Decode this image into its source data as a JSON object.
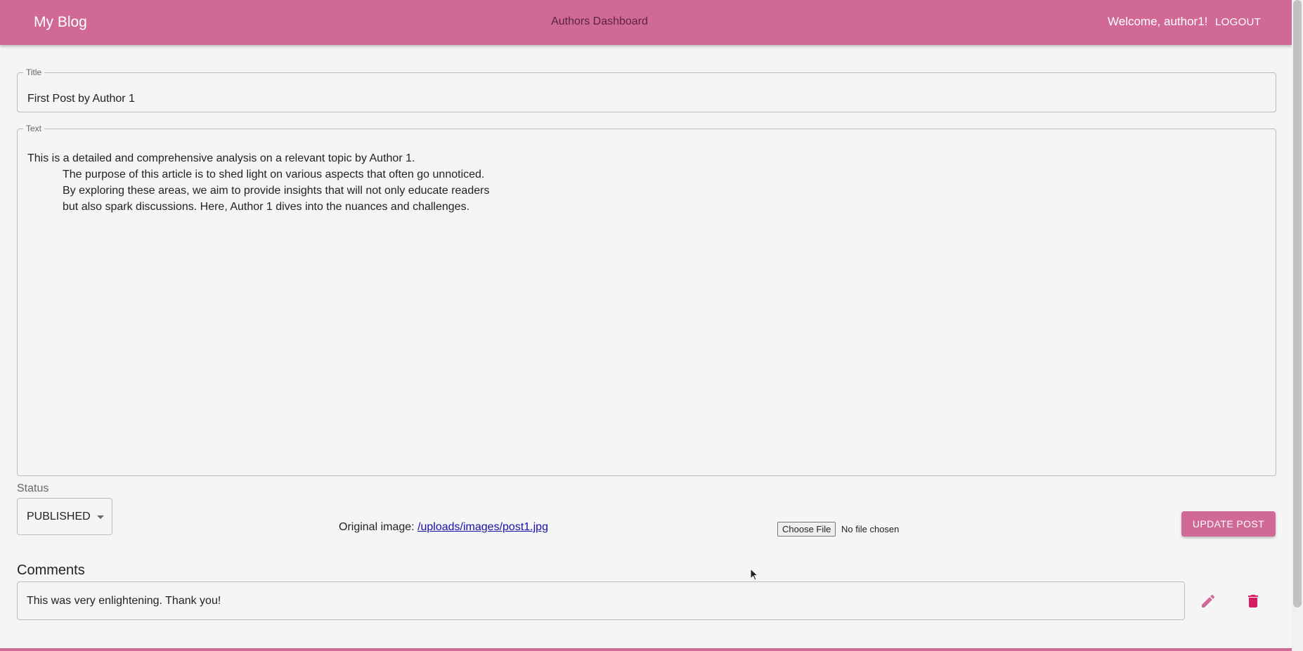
{
  "appbar": {
    "brand": "My Blog",
    "title": "Authors Dashboard",
    "welcome": "Welcome, author1!",
    "logout_label": "LOGOUT"
  },
  "form": {
    "title_label": "Title",
    "title_value": "First Post by Author 1",
    "text_label": "Text",
    "text_lines": [
      "This is a detailed and comprehensive analysis on a relevant topic by Author 1.",
      "The purpose of this article is to shed light on various aspects that often go unnoticed.",
      "By exploring these areas, we aim to provide insights that will not only educate readers",
      "but also spark discussions. Here, Author 1 dives into the nuances and challenges."
    ],
    "status_label": "Status",
    "status_value": "PUBLISHED",
    "original_image_label": "Original image:",
    "original_image_link": "/uploads/images/post1.jpg",
    "file_button_label": "Choose File",
    "file_status": "No file chosen",
    "update_button_label": "UPDATE POST"
  },
  "comments": {
    "heading": "Comments",
    "items": [
      {
        "text": "This was very enlightening. Thank you!"
      }
    ]
  },
  "colors": {
    "primary": "#d06996",
    "delete": "#d81b60",
    "link": "#1a0dab"
  }
}
